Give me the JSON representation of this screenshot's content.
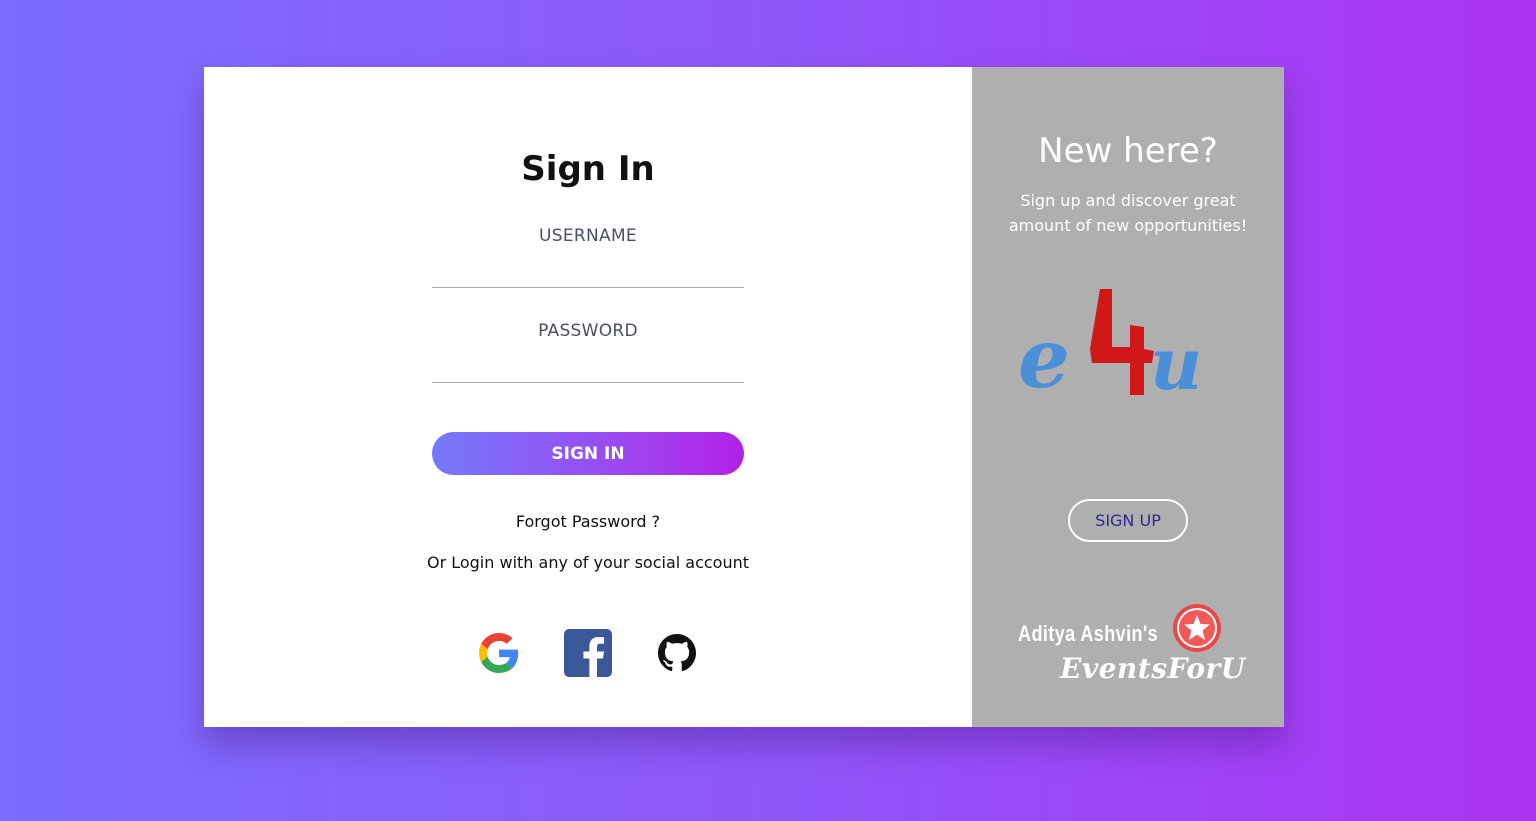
{
  "signin": {
    "title": "Sign In",
    "username_label": "USERNAME",
    "password_label": "PASSWORD",
    "button_label": "SIGN IN",
    "forgot_password": "Forgot Password ?",
    "social_text": "Or Login with any of your social account",
    "social": [
      {
        "name": "google-icon"
      },
      {
        "name": "facebook-icon"
      },
      {
        "name": "github-icon"
      }
    ]
  },
  "signup_panel": {
    "title": "New here?",
    "description": "Sign up and discover great amount of new opportunities!",
    "logo_text": "e4u",
    "button_label": "SIGN UP",
    "brand_name": "Aditya Ashvin's",
    "brand_sub": "EventsForU"
  },
  "colors": {
    "background_start": "#7b6dfd",
    "background_end": "#ab34f2",
    "panel_gray": "#b0afb0",
    "button_gradient_start": "#7479fb",
    "button_gradient_end": "#b221e6",
    "logo_blue": "#4a90d9",
    "logo_red": "#d01818"
  }
}
